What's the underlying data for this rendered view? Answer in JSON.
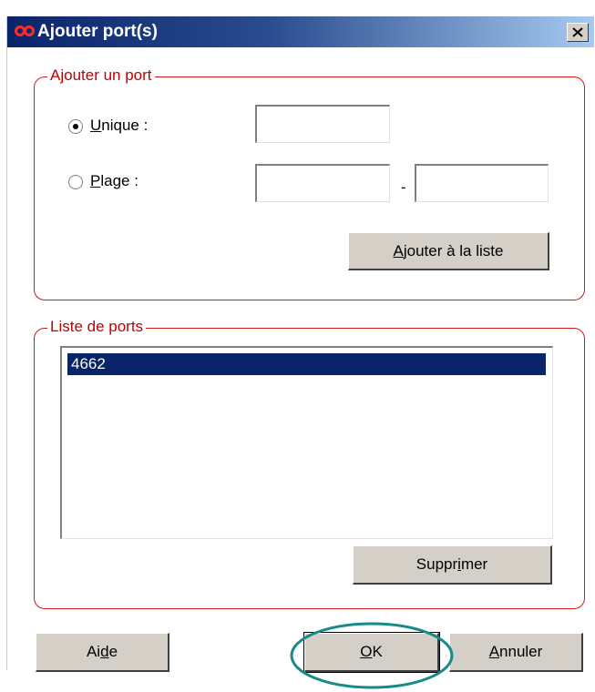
{
  "window": {
    "title": "Ajouter port(s)",
    "icon": "infinity-icon",
    "close_icon": "close-icon"
  },
  "add_port": {
    "legend": "Ajouter un port",
    "single": {
      "label": "Unique :",
      "selected": true,
      "value": ""
    },
    "range": {
      "label": "Plage :",
      "selected": false,
      "from": "",
      "separator": "-",
      "to": ""
    },
    "add_button": "Ajouter à la liste"
  },
  "port_list": {
    "legend": "Liste de ports",
    "items": [
      "4662"
    ],
    "selected_index": 0,
    "remove_button": "Supprimer"
  },
  "footer": {
    "help_button": "Aide",
    "ok_button": "OK",
    "cancel_button": "Annuler"
  },
  "colors": {
    "group_border": "#d11a1a",
    "legend_text": "#c00000",
    "highlight_ellipse": "#178a8a",
    "selection": "#0a246a",
    "button_face": "#d4d0c8"
  }
}
